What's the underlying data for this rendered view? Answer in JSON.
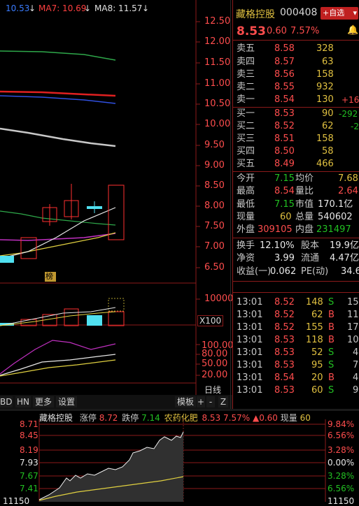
{
  "kline": {
    "ma_values": [
      {
        "label": "10.53",
        "color": "#3a7cff"
      },
      {
        "label": "MA7: 10.69",
        "color": "#ff4040"
      },
      {
        "label": "MA8: 11.57",
        "color": "#e0e0e0"
      }
    ],
    "price_axis": [
      "12.50",
      "12.00",
      "11.50",
      "11.00",
      "10.50",
      "10.00",
      "9.50",
      "9.00",
      "8.50",
      "8.00",
      "7.50",
      "7.00",
      "6.50"
    ],
    "volume_axis": [
      "10000",
      "X100"
    ],
    "volume_note": "榜",
    "osc_axis": [
      "100.00",
      "80.00",
      "50.00",
      "20.00"
    ],
    "period_label": "日线"
  },
  "toolbar": {
    "left_items": [
      "BD",
      "HN",
      "更多",
      "设置"
    ],
    "right_items": [
      "模板",
      "+",
      "-",
      "Z"
    ]
  },
  "quote": {
    "name": "藏格控股",
    "code": "000408",
    "add_button": "+自选",
    "price": "8.53",
    "change": "0.60",
    "change_pct": "7.57%",
    "asks": [
      {
        "label": "卖五",
        "price": "8.58",
        "vol": "328",
        "delta": ""
      },
      {
        "label": "卖四",
        "price": "8.57",
        "vol": "63",
        "delta": ""
      },
      {
        "label": "卖三",
        "price": "8.56",
        "vol": "158",
        "delta": ""
      },
      {
        "label": "卖二",
        "price": "8.55",
        "vol": "932",
        "delta": ""
      },
      {
        "label": "卖一",
        "price": "8.54",
        "vol": "130",
        "delta": "+16"
      }
    ],
    "bids": [
      {
        "label": "买一",
        "price": "8.53",
        "vol": "90",
        "delta": "-292"
      },
      {
        "label": "买二",
        "price": "8.52",
        "vol": "62",
        "delta": "-2"
      },
      {
        "label": "买三",
        "price": "8.51",
        "vol": "158",
        "delta": ""
      },
      {
        "label": "买四",
        "price": "8.50",
        "vol": "58",
        "delta": ""
      },
      {
        "label": "买五",
        "price": "8.49",
        "vol": "466",
        "delta": ""
      }
    ],
    "stats": {
      "open_l": "今开",
      "open": "7.15",
      "avg_l": "均价",
      "avg": "7.68",
      "high_l": "最高",
      "high": "8.54",
      "vr_l": "量比",
      "vr": "2.64",
      "low_l": "最低",
      "low": "7.15",
      "mcap_l": "市值",
      "mcap": "170.1亿",
      "cur_l": "现量",
      "cur": "60",
      "total_l": "总量",
      "total": "540602",
      "outer_l": "外盘",
      "outer": "309105",
      "inner_l": "内盘",
      "inner": "231497",
      "turn_l": "换手",
      "turn": "12.10%",
      "cap_l": "股本",
      "cap": "19.9亿",
      "nav_l": "净资",
      "nav": "3.99",
      "float_l": "流通",
      "float": "4.47亿",
      "eps_l": "收益(一)",
      "eps": "0.062",
      "pe_l": "PE(动)",
      "pe": "34.6"
    },
    "ticks": [
      {
        "time": "13:01",
        "price": "8.52",
        "vol": "148",
        "side": "S",
        "n": "15"
      },
      {
        "time": "13:01",
        "price": "8.52",
        "vol": "62",
        "side": "B",
        "n": "11"
      },
      {
        "time": "13:01",
        "price": "8.52",
        "vol": "155",
        "side": "B",
        "n": "17"
      },
      {
        "time": "13:01",
        "price": "8.53",
        "vol": "118",
        "side": "B",
        "n": "10"
      },
      {
        "time": "13:01",
        "price": "8.53",
        "vol": "52",
        "side": "S",
        "n": "4"
      },
      {
        "time": "13:01",
        "price": "8.53",
        "vol": "95",
        "side": "S",
        "n": "7"
      },
      {
        "time": "13:01",
        "price": "8.54",
        "vol": "20",
        "side": "B",
        "n": "4"
      },
      {
        "time": "13:01",
        "price": "8.53",
        "vol": "60",
        "side": "S",
        "n": "9"
      }
    ]
  },
  "intraday": {
    "name": "藏格控股",
    "limit_up_l": "涨停",
    "limit_up": "8.72",
    "limit_down_l": "跌停",
    "limit_down": "7.14",
    "sector": "农药化肥",
    "price": "8.53",
    "pct": "7.57%",
    "change": "▲0.60",
    "cur_l": "现量",
    "cur": "60",
    "left_axis": [
      "8.71",
      "8.45",
      "8.19",
      "7.93",
      "7.67",
      "7.41",
      "11150"
    ],
    "right_axis": [
      "9.84%",
      "6.56%",
      "3.28%",
      "0.00%",
      "3.28%",
      "6.56%",
      "11150"
    ]
  }
}
